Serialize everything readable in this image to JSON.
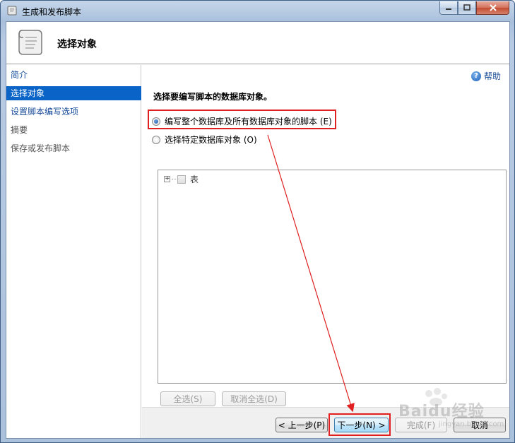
{
  "window": {
    "title": "生成和发布脚本",
    "controls": {
      "minimize": "minimize",
      "maximize": "maximize",
      "close": "close"
    }
  },
  "header": {
    "title": "选择对象"
  },
  "nav": {
    "items": [
      {
        "label": "简介",
        "state": "link"
      },
      {
        "label": "选择对象",
        "state": "selected"
      },
      {
        "label": "设置脚本编写选项",
        "state": "link"
      },
      {
        "label": "摘要",
        "state": "disabled"
      },
      {
        "label": "保存或发布脚本",
        "state": "disabled"
      }
    ]
  },
  "content": {
    "help_label": "帮助",
    "prompt": "选择要编写脚本的数据库对象。",
    "options": [
      {
        "label": "编写整个数据库及所有数据库对象的脚本 (E)",
        "checked": true
      },
      {
        "label": "选择特定数据库对象 (O)",
        "checked": false
      }
    ],
    "tree": {
      "items": [
        {
          "label": "表",
          "checked": false
        }
      ]
    },
    "select_all": "全选(S)",
    "deselect_all": "取消全选(D)"
  },
  "footer": {
    "prev": "< 上一步(P)",
    "next": "下一步(N) >",
    "finish": "完成(F)",
    "cancel": "取消"
  },
  "watermark": {
    "brand": "Baidu经验",
    "sub": "jingyan.baidu.com"
  },
  "colors": {
    "nav_selected": "#0a64c8",
    "link": "#1a4d9a",
    "annotation": "#e02020"
  }
}
